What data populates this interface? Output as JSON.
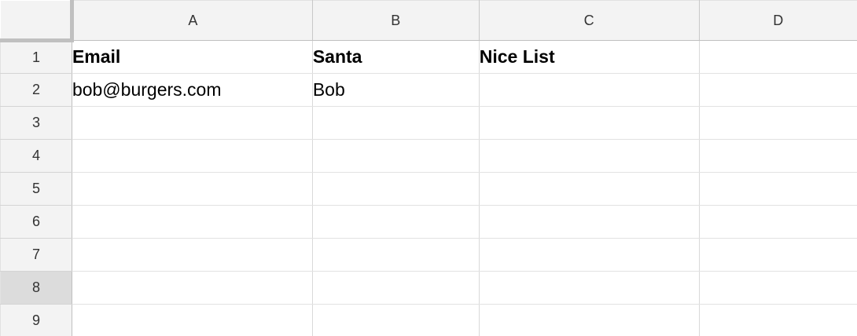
{
  "sheet": {
    "columns": [
      "A",
      "B",
      "C",
      "D"
    ],
    "rows": [
      {
        "number": "1",
        "cells": [
          "Email",
          "Santa",
          "Nice List",
          ""
        ]
      },
      {
        "number": "2",
        "cells": [
          "bob@burgers.com",
          "Bob",
          "",
          ""
        ]
      },
      {
        "number": "3",
        "cells": [
          "",
          "",
          "",
          ""
        ]
      },
      {
        "number": "4",
        "cells": [
          "",
          "",
          "",
          ""
        ]
      },
      {
        "number": "5",
        "cells": [
          "",
          "",
          "",
          ""
        ]
      },
      {
        "number": "6",
        "cells": [
          "",
          "",
          "",
          ""
        ]
      },
      {
        "number": "7",
        "cells": [
          "",
          "",
          "",
          ""
        ]
      },
      {
        "number": "8",
        "cells": [
          "",
          "",
          "",
          ""
        ]
      },
      {
        "number": "9",
        "cells": [
          "",
          "",
          "",
          ""
        ]
      }
    ]
  },
  "colors": {
    "header_background": "#f3f3f3",
    "selected_row_header": "#dcdcdc",
    "gridline": "#e2e2e2"
  }
}
